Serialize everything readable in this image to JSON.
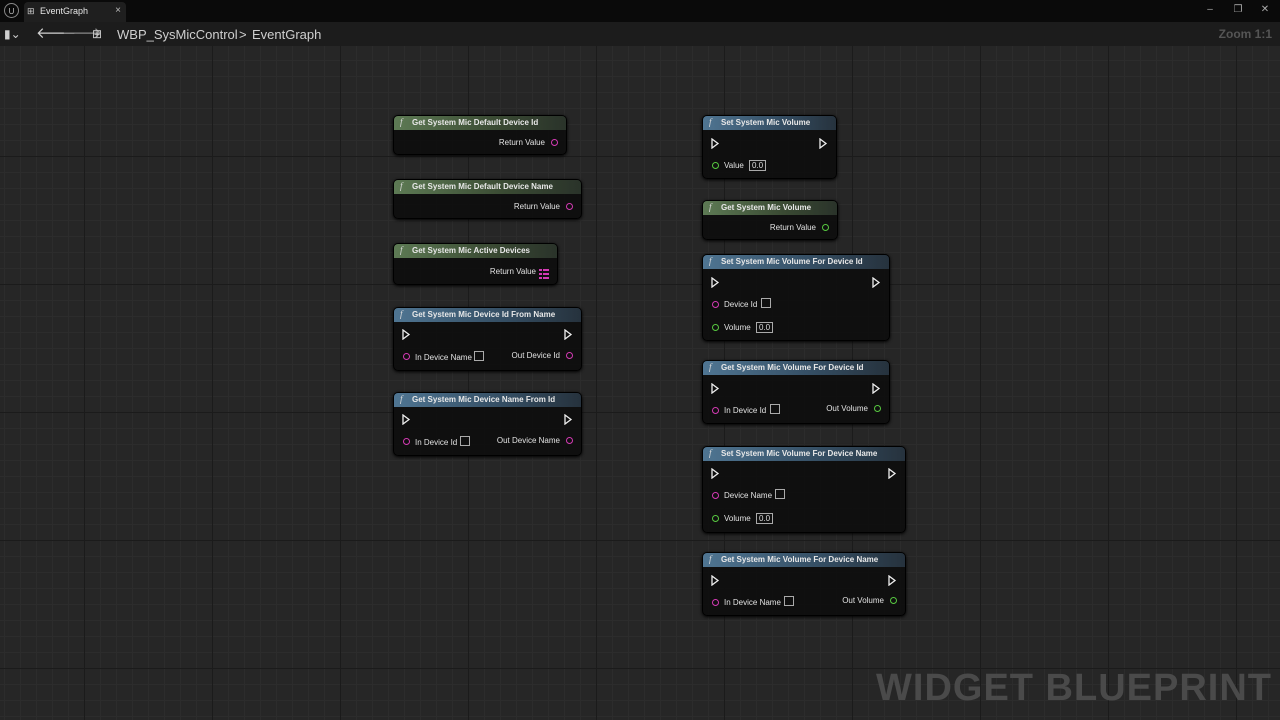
{
  "window": {
    "tab_label": "EventGraph",
    "tab_close": "×",
    "minimize": "–",
    "restore": "❐",
    "close": "✕"
  },
  "toolbar": {
    "breadcrumb_blueprint": "WBP_SysMicControl",
    "breadcrumb_separator": ">",
    "breadcrumb_graph": "EventGraph",
    "zoom": "Zoom 1:1"
  },
  "watermark": "WIDGET BLUEPRINT",
  "colors": {
    "object_pin": "#d43ab4",
    "float_pin": "#57c840",
    "pure_header": "#5d7a54",
    "impure_header": "#4f7592"
  },
  "nodes": {
    "get_default_id": {
      "title": "Get System Mic Default Device Id",
      "out": "Return Value"
    },
    "get_default_name": {
      "title": "Get System Mic Default Device Name",
      "out": "Return Value"
    },
    "get_active": {
      "title": "Get System Mic Active Devices",
      "out": "Return Value"
    },
    "id_from_name": {
      "title": "Get System Mic Device Id From Name",
      "in": "In Device Name",
      "out": "Out Device Id"
    },
    "name_from_id": {
      "title": "Get System Mic Device Name From Id",
      "in": "In Device Id",
      "out": "Out Device Name"
    },
    "set_volume": {
      "title": "Set System Mic Volume",
      "in": "Value",
      "in_value": "0.0"
    },
    "get_volume": {
      "title": "Get System Mic Volume",
      "out": "Return Value"
    },
    "set_vol_id": {
      "title": "Set System Mic Volume For Device Id",
      "in1": "Device Id",
      "in2": "Volume",
      "in2_value": "0.0"
    },
    "get_vol_id": {
      "title": "Get System Mic Volume For Device Id",
      "in": "In Device Id",
      "out": "Out Volume"
    },
    "set_vol_name": {
      "title": "Set System Mic Volume For Device Name",
      "in1": "Device Name",
      "in2": "Volume",
      "in2_value": "0.0"
    },
    "get_vol_name": {
      "title": "Get System Mic Volume For Device Name",
      "in": "In Device Name",
      "out": "Out Volume"
    }
  }
}
